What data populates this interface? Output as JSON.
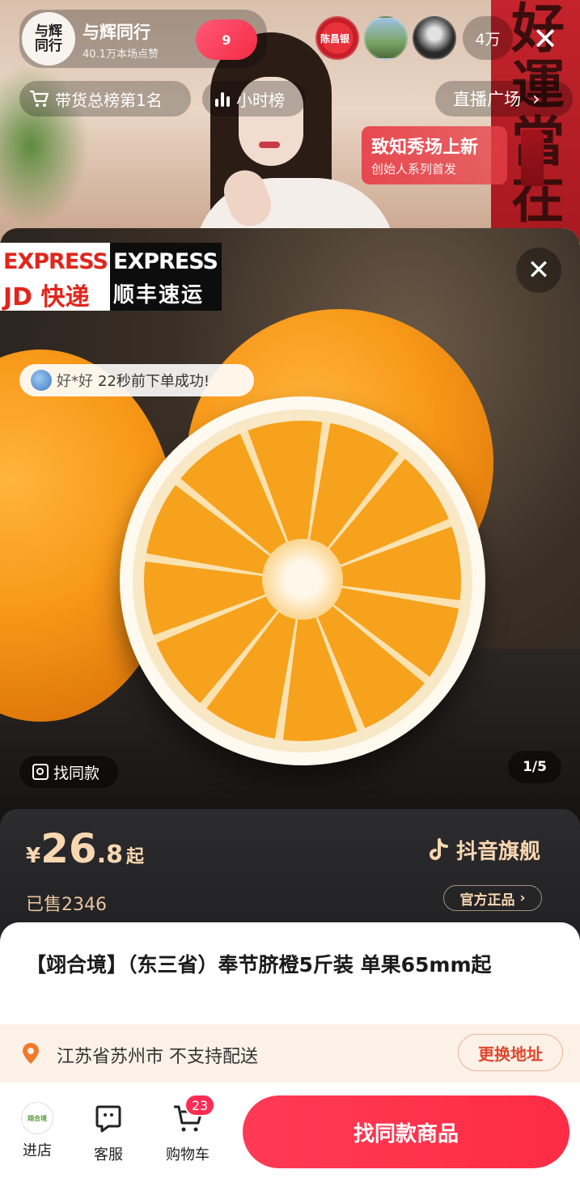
{
  "live": {
    "host_avatar_text": "与辉\n同行",
    "host_name": "与辉同行",
    "host_likes": "40.1万本场点赞",
    "follow_count": "9",
    "viewer1_label": "陈昌银",
    "viewer_count": "4万",
    "rank_label": "带货总榜第1名",
    "hour_rank_label": "小时榜",
    "plaza_label": "直播广场",
    "promo_title": "致知秀场上新",
    "promo_subtitle": "创始人系列首发",
    "banner_text": "好運當在"
  },
  "product": {
    "badge_jd_line1": "EXPRESS",
    "badge_jd_line2": "JD 快递",
    "badge_sf_line1": "EXPRESS",
    "badge_sf_line2": "顺丰速运",
    "toast_user": "好*好",
    "toast_text": "22秒前下单成功!",
    "find_similar_label": "找同款",
    "page_indicator": "1/5",
    "price_currency": "¥",
    "price_integer": "26",
    "price_decimal": ".8",
    "price_suffix": "起",
    "sold_label": "已售2346",
    "flagship_label": "抖音旗舰",
    "official_label": "官方正品",
    "title": "【翊合境】（东三省）奉节脐橙5斤装 单果65mm起",
    "address_text": "江苏省苏州市 不支持配送",
    "change_address_label": "更换地址"
  },
  "bottom_bar": {
    "shop_logo_text": "翊合境",
    "shop_label": "进店",
    "service_label": "客服",
    "cart_label": "购物车",
    "cart_count": "23",
    "cta_label": "找同款商品"
  },
  "colors": {
    "accent": "#fe2c55",
    "price": "#f9d7b1",
    "address_bg": "#fcf1e6"
  }
}
